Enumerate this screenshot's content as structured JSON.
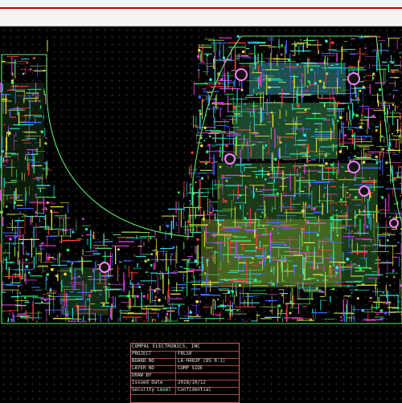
{
  "window": {
    "title": ""
  },
  "canvas": {
    "background": "#000000",
    "grid_color": "#2a2a2a",
    "accent_red": "#c00000"
  },
  "title_block": {
    "company": "COMPAL ELECTRONICS, INC",
    "rows": [
      {
        "key": "PROJECT",
        "value": "FRL50"
      },
      {
        "key": "BOARD NO",
        "value": "LA-H483P (DS 0.1)"
      },
      {
        "key": "LAYER NO",
        "value": "COMP SIDE"
      },
      {
        "key": "DRAW BY",
        "value": ""
      },
      {
        "key": "Issued Date",
        "value": "2018/10/12"
      },
      {
        "key": "Security Level",
        "value": "Confidential"
      }
    ]
  },
  "board_layers": [
    "green",
    "magenta",
    "cyan",
    "red",
    "blue",
    "yellow"
  ],
  "layer_colors": {
    "green": "#2ee86a",
    "magenta": "#e040e0",
    "cyan": "#30e8e8",
    "red": "#f03a3a",
    "blue": "#3a6cff",
    "yellow": "#e8e040",
    "olive": "#9ac84a"
  }
}
